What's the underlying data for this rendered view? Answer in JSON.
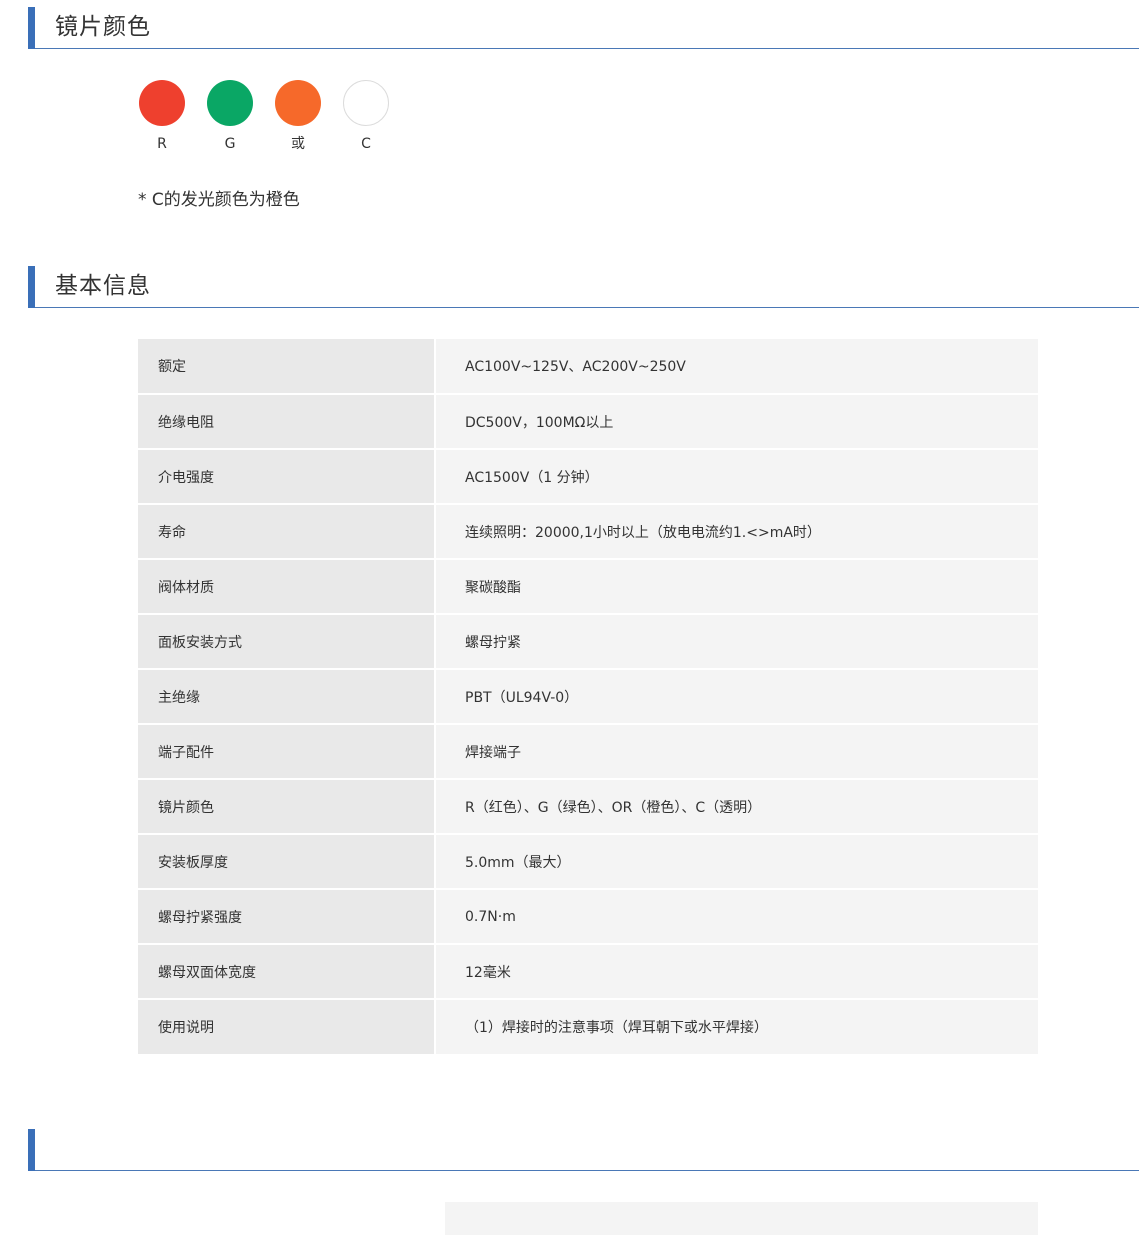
{
  "sections": {
    "lens_color": {
      "title": "镜片颜色"
    },
    "basic_info": {
      "title": "基本信息"
    },
    "third": {
      "title": ""
    }
  },
  "swatches": [
    {
      "label": "R",
      "color": "#ee402e"
    },
    {
      "label": "G",
      "color": "#0aa765"
    },
    {
      "label": "或",
      "color": "#f6692a"
    },
    {
      "label": "C",
      "color": "#ffffff"
    }
  ],
  "note": "* C的发光颜色为橙色",
  "specs": [
    {
      "key": "额定",
      "value": "AC100V~125V、AC200V~250V"
    },
    {
      "key": "绝缘电阻",
      "value": "DC500V，100MΩ以上"
    },
    {
      "key": "介电强度",
      "value": "AC1500V（1 分钟）"
    },
    {
      "key": "寿命",
      "value": "连续照明：20000,1小时以上（放电电流约1.<>mA时）"
    },
    {
      "key": "阀体材质",
      "value": "聚碳酸酯"
    },
    {
      "key": "面板安装方式",
      "value": "螺母拧紧"
    },
    {
      "key": "主绝缘",
      "value": "PBT（UL94V-0）"
    },
    {
      "key": "端子配件",
      "value": "焊接端子"
    },
    {
      "key": "镜片颜色",
      "value": "R（红色）、G（绿色）、OR（橙色）、C（透明）"
    },
    {
      "key": "安装板厚度",
      "value": "5.0mm（最大）"
    },
    {
      "key": "螺母拧紧强度",
      "value": "0.7N·m"
    },
    {
      "key": "螺母双面体宽度",
      "value": "12毫米"
    },
    {
      "key": "使用说明",
      "value": "（1）焊接时的注意事项（焊耳朝下或水平焊接）"
    }
  ],
  "theme": {
    "accent": "#3a6fb8",
    "key_bg": "#e9e9e9",
    "value_bg": "#f4f4f4"
  }
}
